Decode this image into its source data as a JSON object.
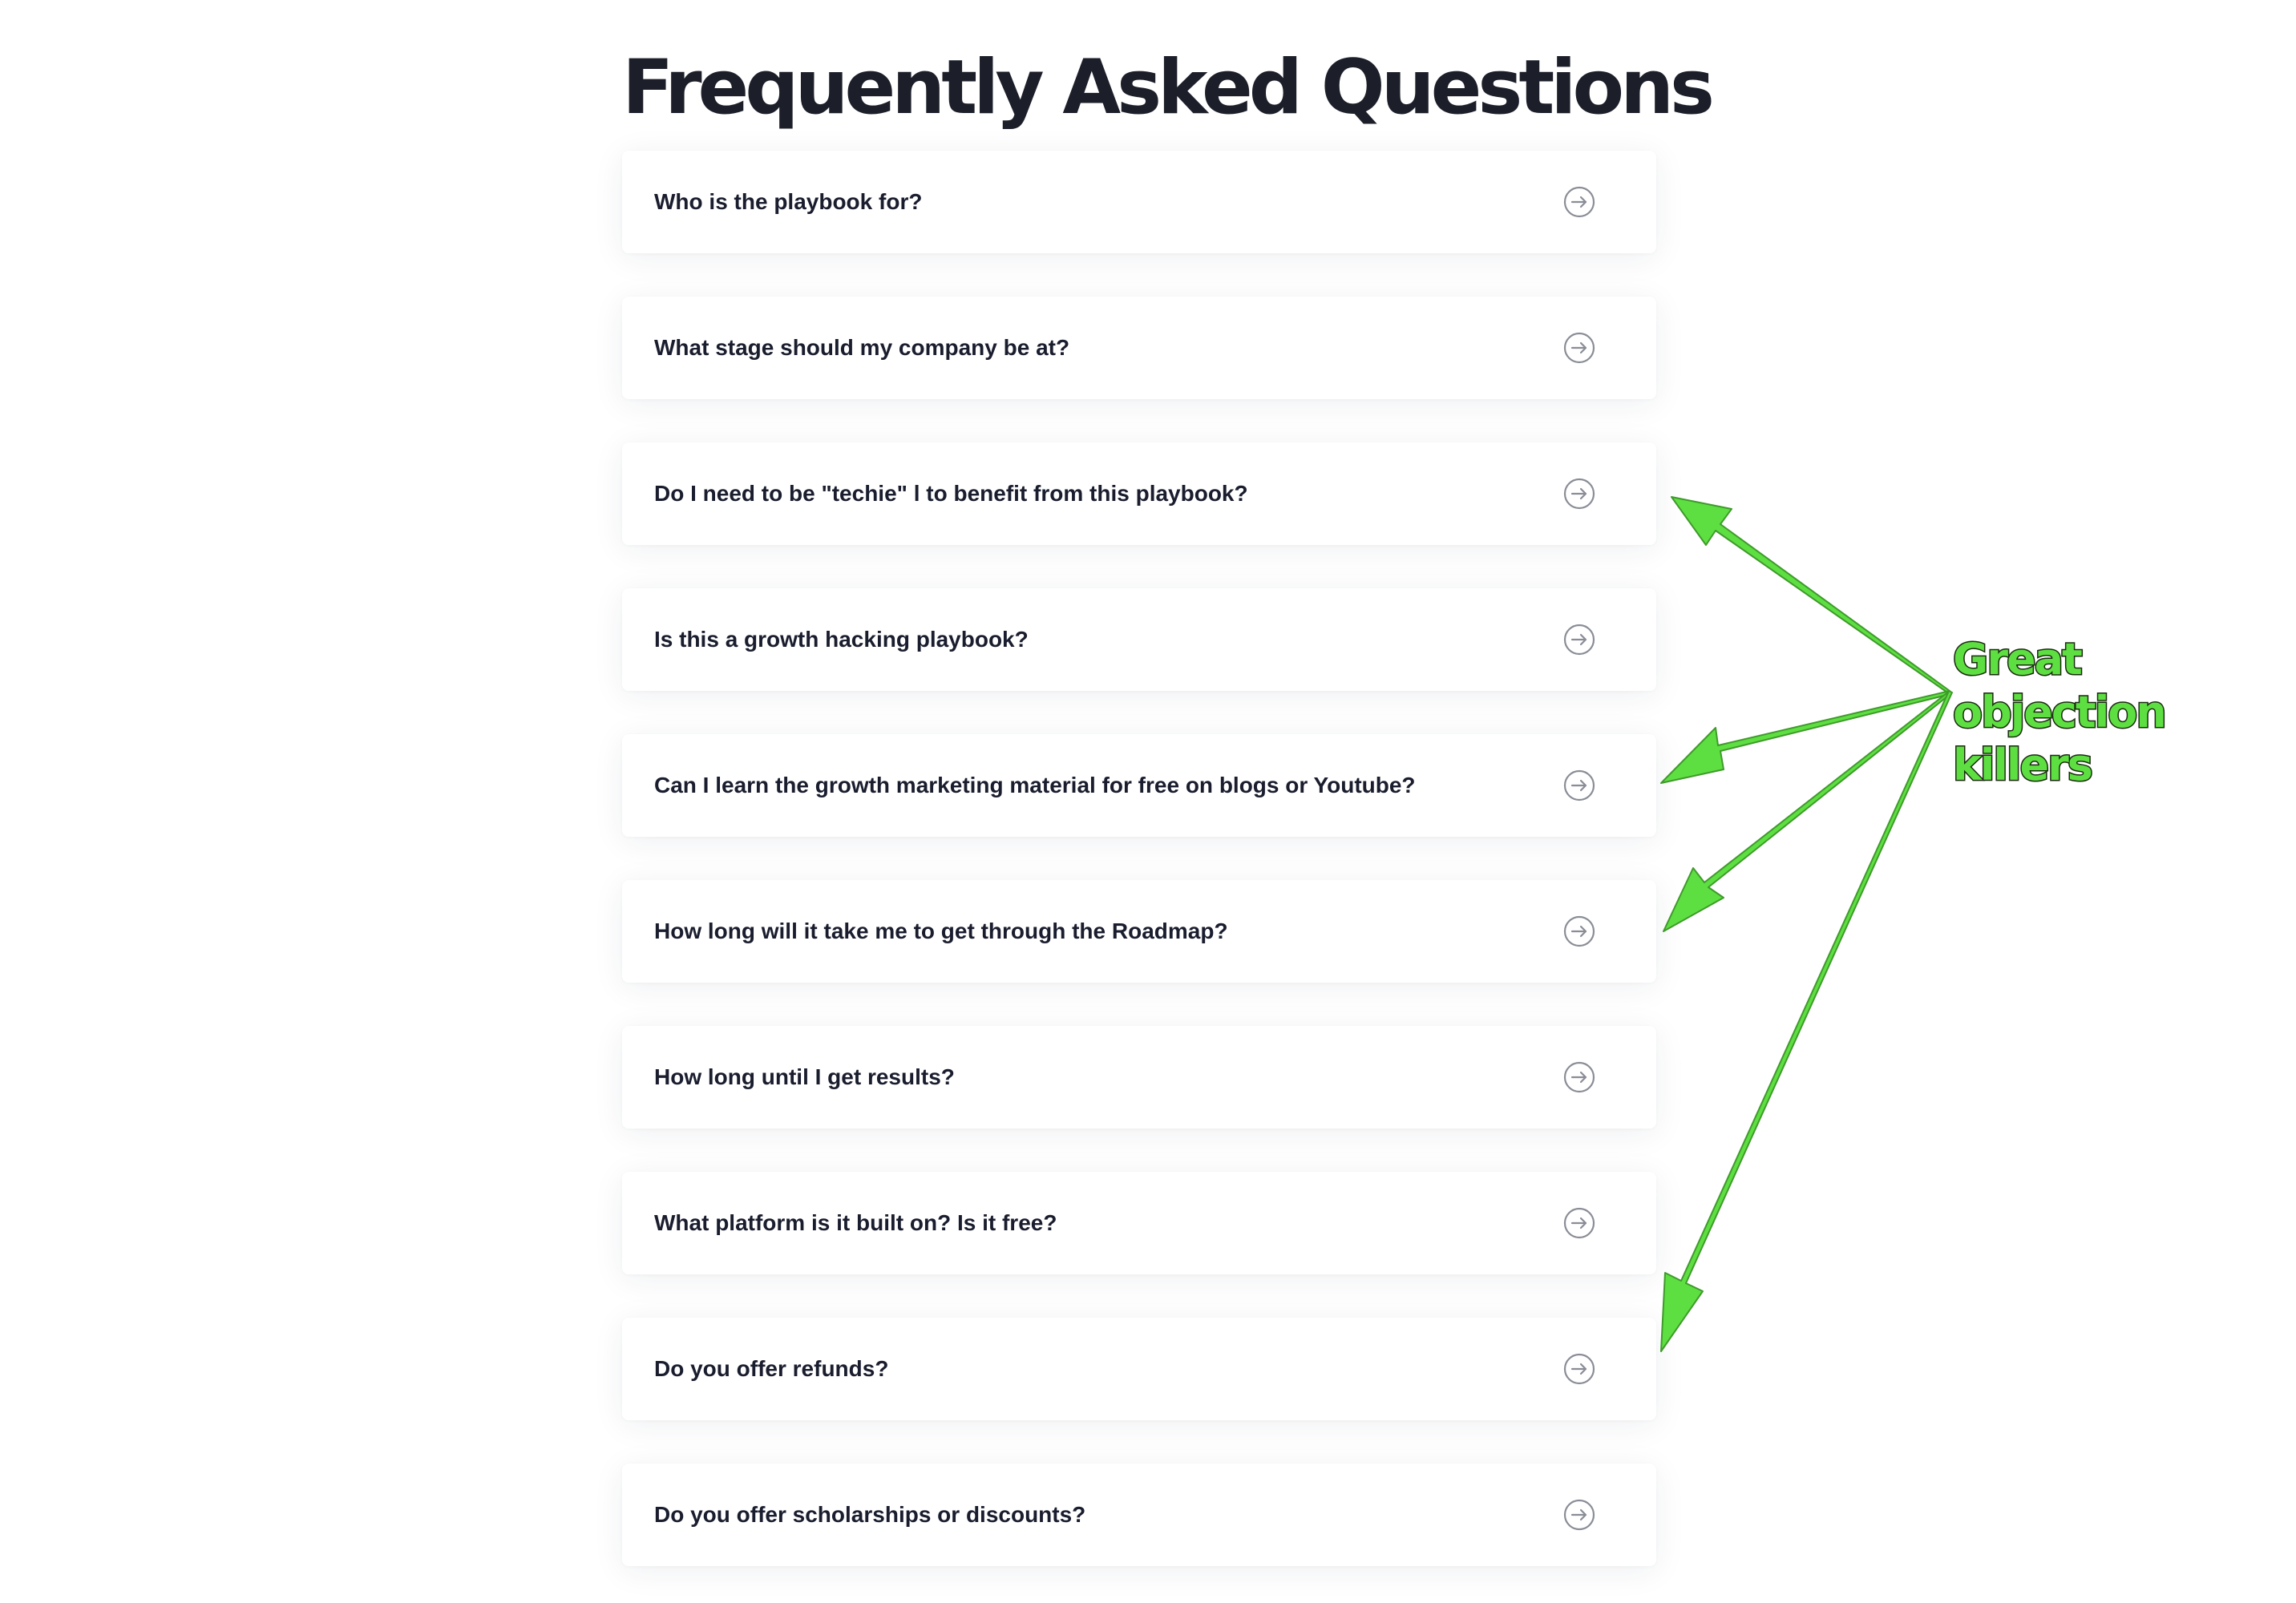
{
  "page": {
    "title": "Frequently Asked Questions"
  },
  "faq": {
    "items": [
      {
        "question": "Who is the playbook for?"
      },
      {
        "question": "What stage should my company be at?"
      },
      {
        "question": "Do I need to be \"techie\" l to benefit from this playbook?"
      },
      {
        "question": "Is this a growth hacking playbook?"
      },
      {
        "question": "Can I learn the growth marketing material for free on blogs or Youtube?"
      },
      {
        "question": "How long will it take me to get through the Roadmap?"
      },
      {
        "question": "How long until I get results?"
      },
      {
        "question": "What platform is it built on? Is it free?"
      },
      {
        "question": "Do you offer refunds?"
      },
      {
        "question": "Do you offer scholarships or discounts?"
      }
    ],
    "expand_icon": "arrow-right-circle-icon"
  },
  "annotation": {
    "line1": "Great objection",
    "line2": "killers",
    "color": "#5ddf41",
    "outline_color": "#1a2a10"
  },
  "colors": {
    "title": "#1c1f29",
    "question_text": "#1a1d2e",
    "icon": "#8a8d96"
  }
}
